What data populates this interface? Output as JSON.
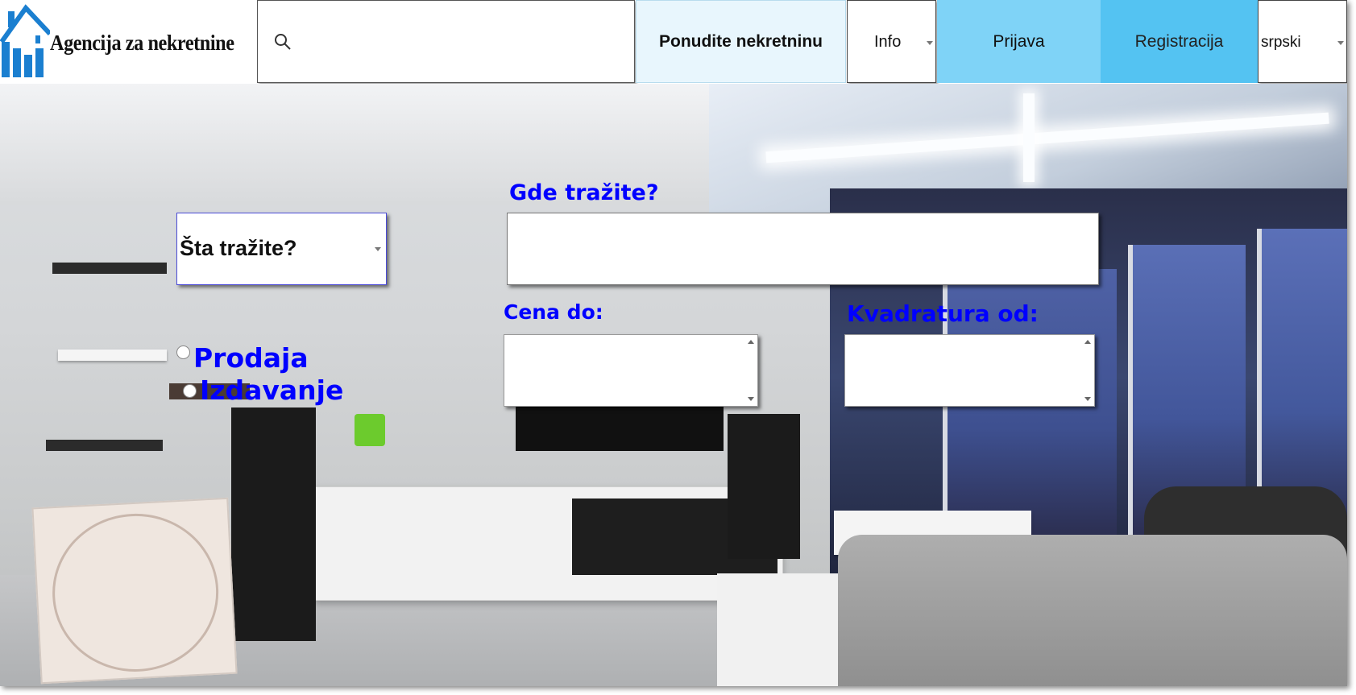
{
  "header": {
    "logo_text": "Agencija za nekretnine",
    "search_placeholder": "",
    "offer_button": "Ponudite nekretninu",
    "info_select": "Info",
    "login_button": "Prijava",
    "register_button": "Registracija",
    "language_select": "srpski"
  },
  "search_form": {
    "what_select": "Šta tražite?",
    "where_label": "Gde tražite?",
    "where_value": "",
    "price_label": "Cena do:",
    "price_value": "",
    "area_label": "Kvadratura od:",
    "area_value": "",
    "radio_options": [
      "Prodaja",
      "Izdavanje"
    ]
  },
  "colors": {
    "label_blue": "#0000ff",
    "login_bg": "#7fd3f7",
    "register_bg": "#54c3f2",
    "offer_bg": "#e8f6fd"
  },
  "icons": {
    "search": "search-icon",
    "logo": "house-logo-icon"
  }
}
